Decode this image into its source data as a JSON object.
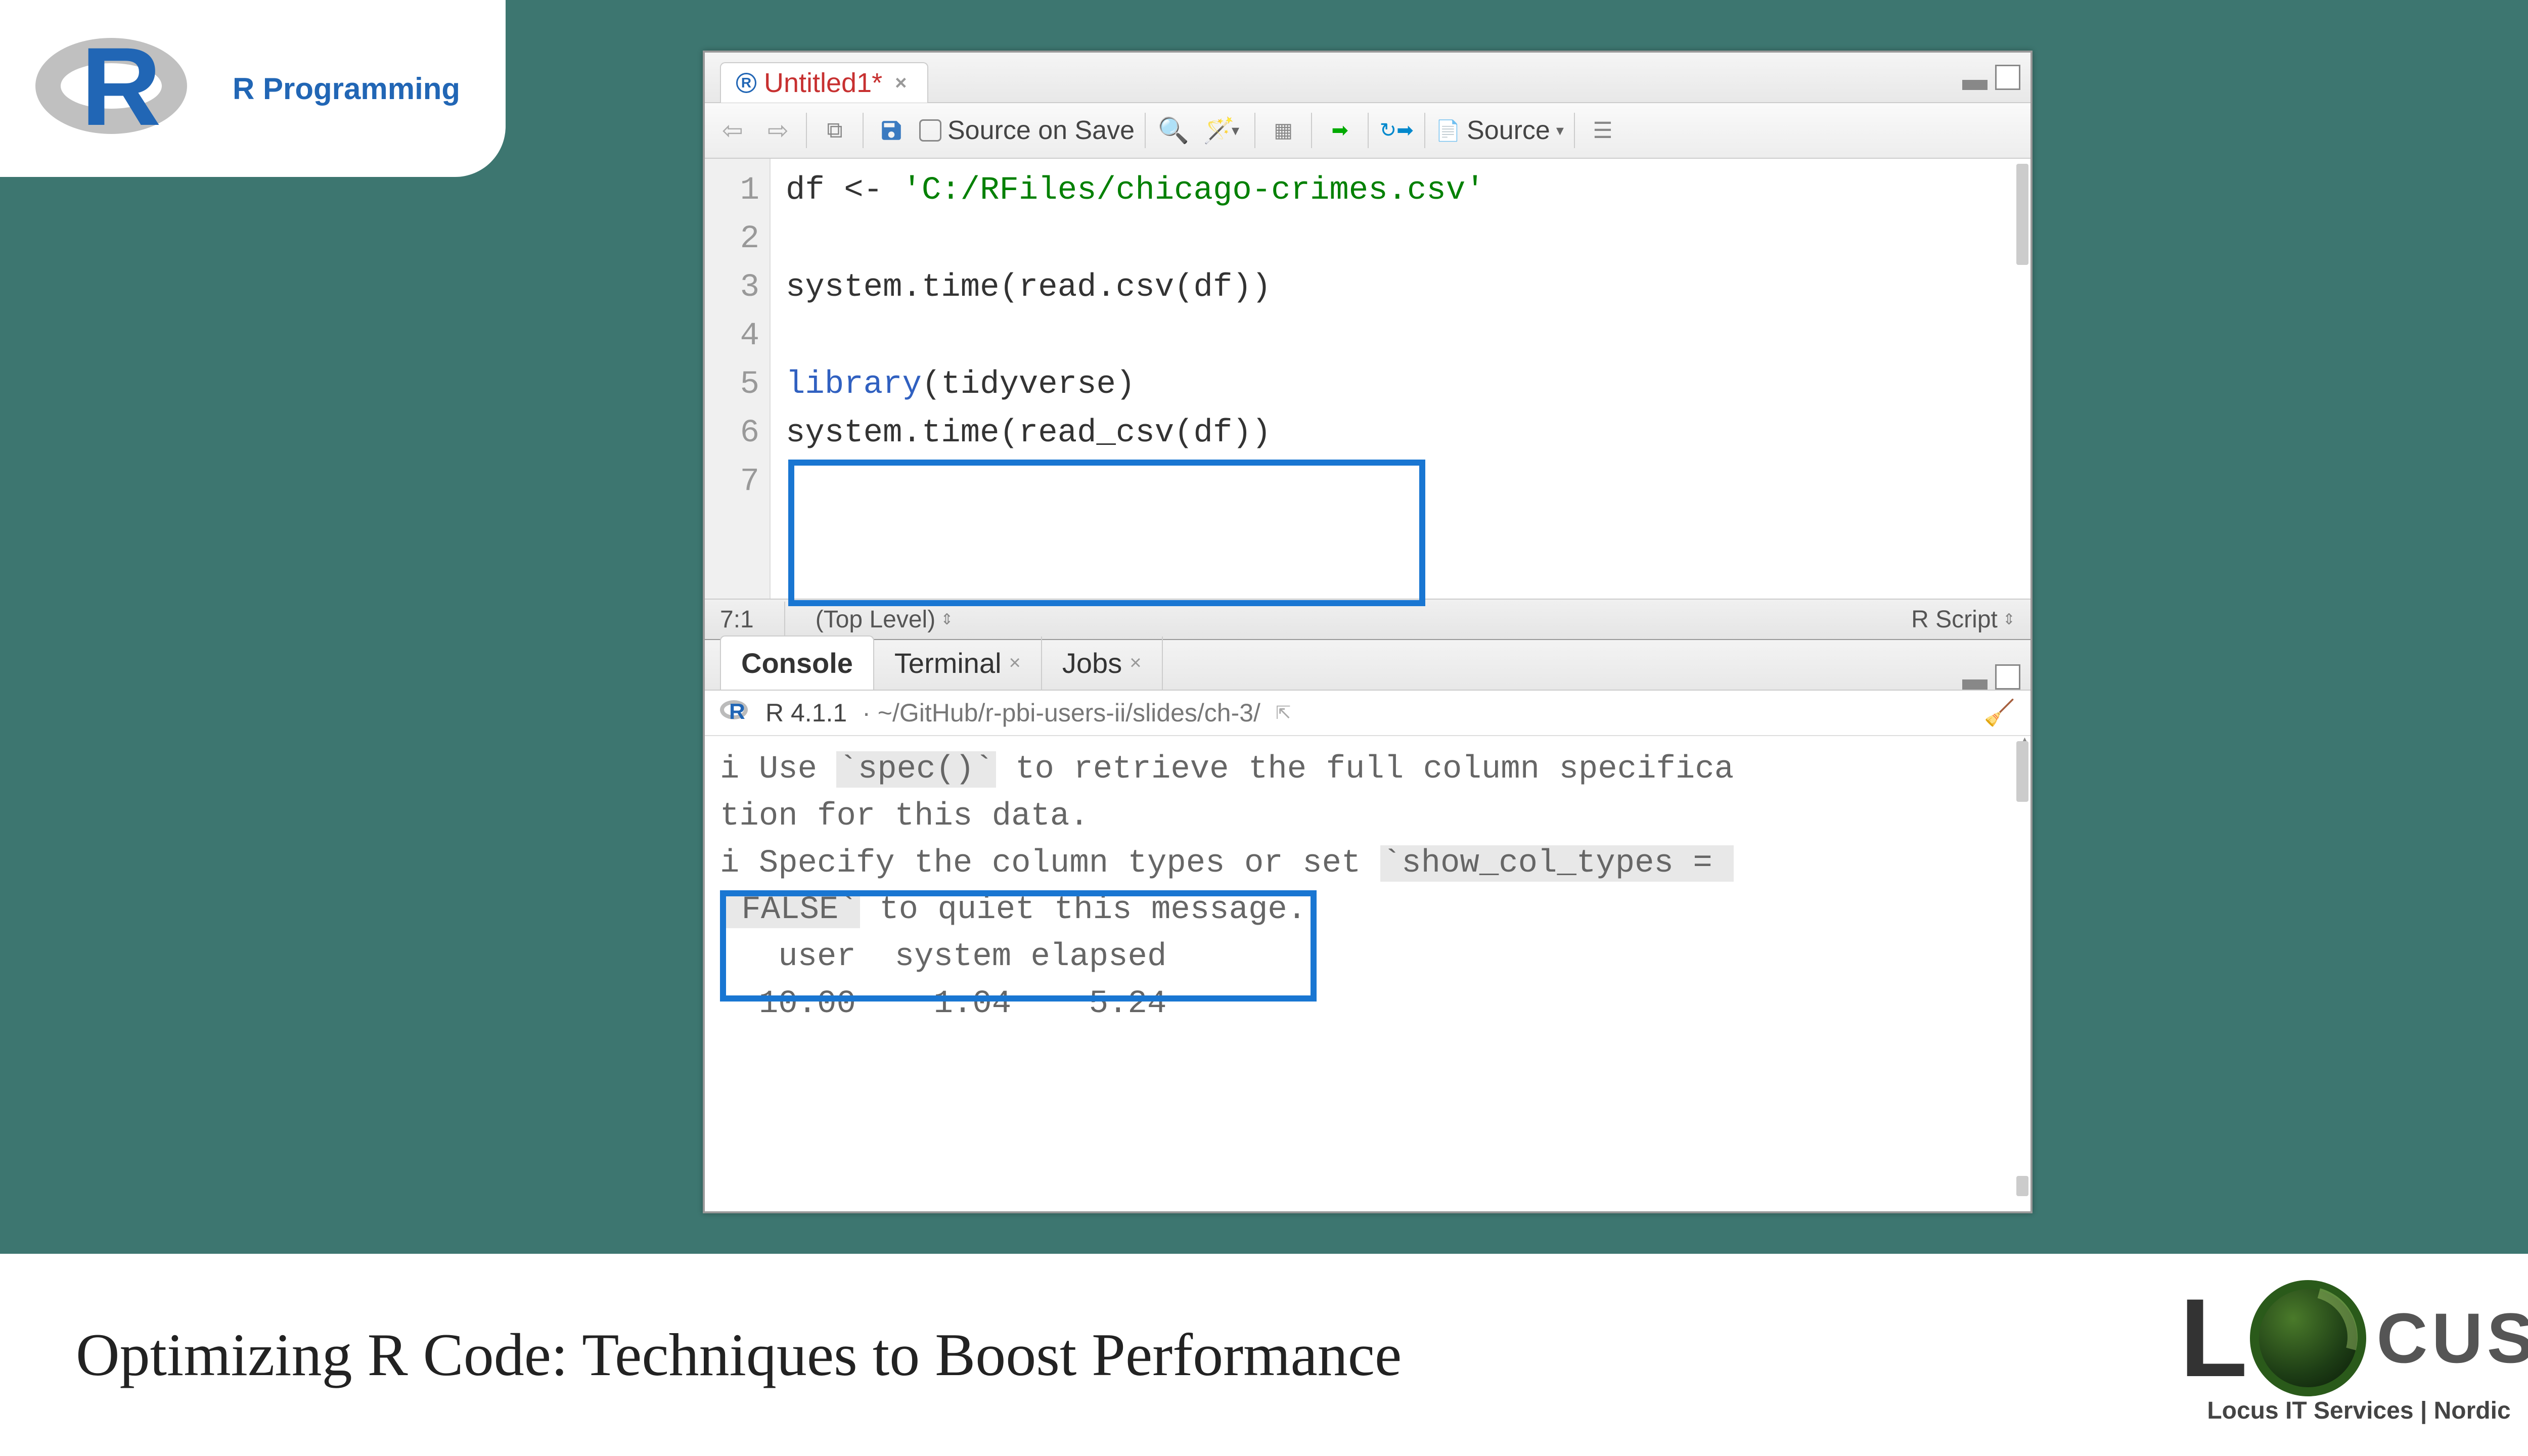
{
  "badge": {
    "label": "R Programming"
  },
  "editor": {
    "tab_name": "Untitled1*",
    "source_on_save": "Source on Save",
    "source_btn": "Source",
    "cursor_pos": "7:1",
    "scope": "(Top Level)",
    "script_type": "R Script",
    "code": {
      "l1_var": "df",
      "l1_op": " <- ",
      "l1_str": "'C:/RFiles/chicago-crimes.csv'",
      "l3": "system.time(read.csv(df))",
      "l5_fn": "library",
      "l5_rest": "(tidyverse)",
      "l6": "system.time(read_csv(df))"
    },
    "line_numbers": [
      "1",
      "2",
      "3",
      "4",
      "5",
      "6",
      "7"
    ]
  },
  "console": {
    "tabs": {
      "console": "Console",
      "terminal": "Terminal",
      "jobs": "Jobs"
    },
    "version": "R 4.1.1",
    "path": "~/GitHub/r-pbi-users-ii/slides/ch-3/",
    "out1a": "i Use ",
    "out1b": "`spec()`",
    "out1c": " to retrieve the full column specifica",
    "out2": "tion for this data.",
    "out3a": "i Specify the column types or set ",
    "out3b": "`show_col_types = ",
    "out4a": " FALSE`",
    "out4b": " to quiet this message.",
    "timing_header": "   user  system elapsed",
    "timing_values": "  10.00    1.04    5.24"
  },
  "footer": {
    "title": "Optimizing R Code: Techniques to Boost Performance",
    "brand_l": "L",
    "brand_rest": "CUS",
    "tagline": "Locus IT Services | Nordic"
  }
}
